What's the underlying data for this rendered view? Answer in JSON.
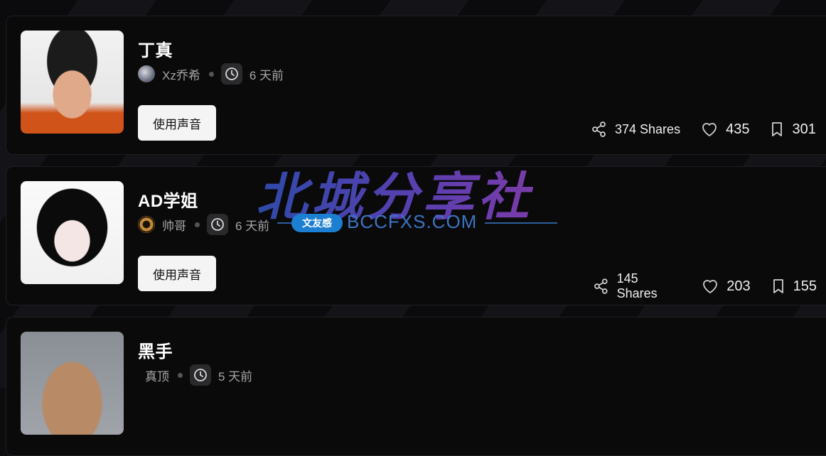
{
  "cards": [
    {
      "title": "丁真",
      "author": "Xz乔希",
      "time": "6 天前",
      "button_label": "使用声音",
      "shares": "374 Shares",
      "likes": "435",
      "saves": "301"
    },
    {
      "title": "AD学姐",
      "author": "帅哥",
      "time": "6 天前",
      "button_label": "使用声音",
      "shares": "145 Shares",
      "likes": "203",
      "saves": "155"
    },
    {
      "title": "黑手",
      "author": "真顶",
      "time": "5 天前"
    }
  ],
  "watermark": {
    "main": "北城分享社",
    "badge": "文友感",
    "domain": "BCCFXS.COM"
  },
  "colors": {
    "background": "#0d0d0f",
    "card": "#0a0a0a",
    "button": "#f4f4f4",
    "watermark_blue": "#1d7fd1"
  }
}
